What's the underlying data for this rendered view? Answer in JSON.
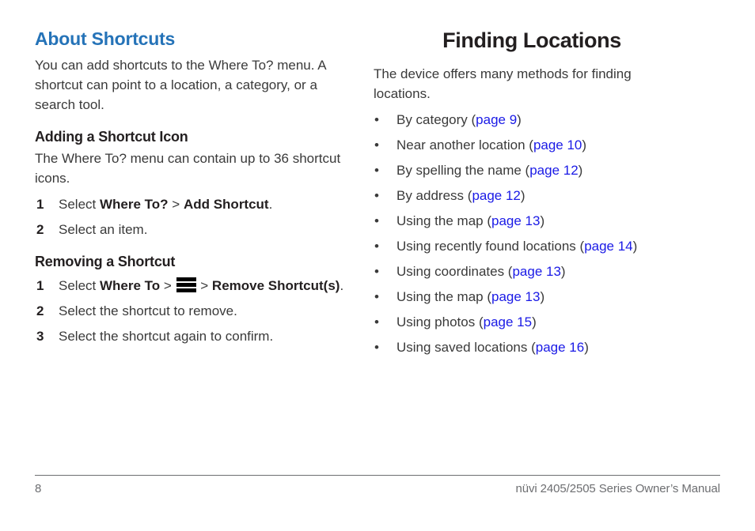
{
  "colors": {
    "section_heading": "#2573b8",
    "body_text": "#3a3a3a",
    "heading_black": "#231f20",
    "link_blue": "#1a1ae6",
    "footer_gray": "#6d6e71"
  },
  "left_column": {
    "section_heading": "About Shortcuts",
    "intro": "You can add shortcuts to the Where To? menu. A shortcut can point to a location, a category, or a search tool.",
    "adding": {
      "heading": "Adding a Shortcut Icon",
      "intro": "The Where To? menu can contain up to 36 shortcut icons.",
      "steps": [
        {
          "num": "1",
          "prefix": "Select ",
          "bold1": "Where To?",
          "sep1": " > ",
          "bold2": "Add Shortcut",
          "suffix": "."
        },
        {
          "num": "2",
          "text": "Select an item."
        }
      ]
    },
    "removing": {
      "heading": "Removing a Shortcut",
      "steps": [
        {
          "num": "1",
          "prefix": "Select ",
          "bold1": "Where To",
          "sep1": " > ",
          "icon": "menu-icon",
          "sep2": " > ",
          "bold2": "Remove Shortcut(s)",
          "suffix": "."
        },
        {
          "num": "2",
          "text": "Select the shortcut to remove."
        },
        {
          "num": "3",
          "text": "Select the shortcut again to confirm."
        }
      ]
    }
  },
  "right_column": {
    "title": "Finding Locations",
    "intro": "The device offers many methods for finding locations.",
    "bullet_marker": "•",
    "bullets": [
      {
        "text": "By category (",
        "link": "page 9",
        "tail": ")"
      },
      {
        "text": "Near another location (",
        "link": "page 10",
        "tail": ")"
      },
      {
        "text": "By spelling the name (",
        "link": "page 12",
        "tail": ")"
      },
      {
        "text": "By address (",
        "link": "page 12",
        "tail": ")"
      },
      {
        "text": "Using the map (",
        "link": "page 13",
        "tail": ")"
      },
      {
        "text": "Using recently found locations (",
        "link": "page 14",
        "tail": ")"
      },
      {
        "text": "Using coordinates (",
        "link": "page 13",
        "tail": ")"
      },
      {
        "text": "Using the map (",
        "link": "page 13",
        "tail": ")"
      },
      {
        "text": "Using photos (",
        "link": "page 15",
        "tail": ")"
      },
      {
        "text": "Using saved locations (",
        "link": "page 16",
        "tail": ")"
      }
    ]
  },
  "footer": {
    "page_number": "8",
    "manual_title": "nüvi 2405/2505 Series Owner’s Manual"
  }
}
